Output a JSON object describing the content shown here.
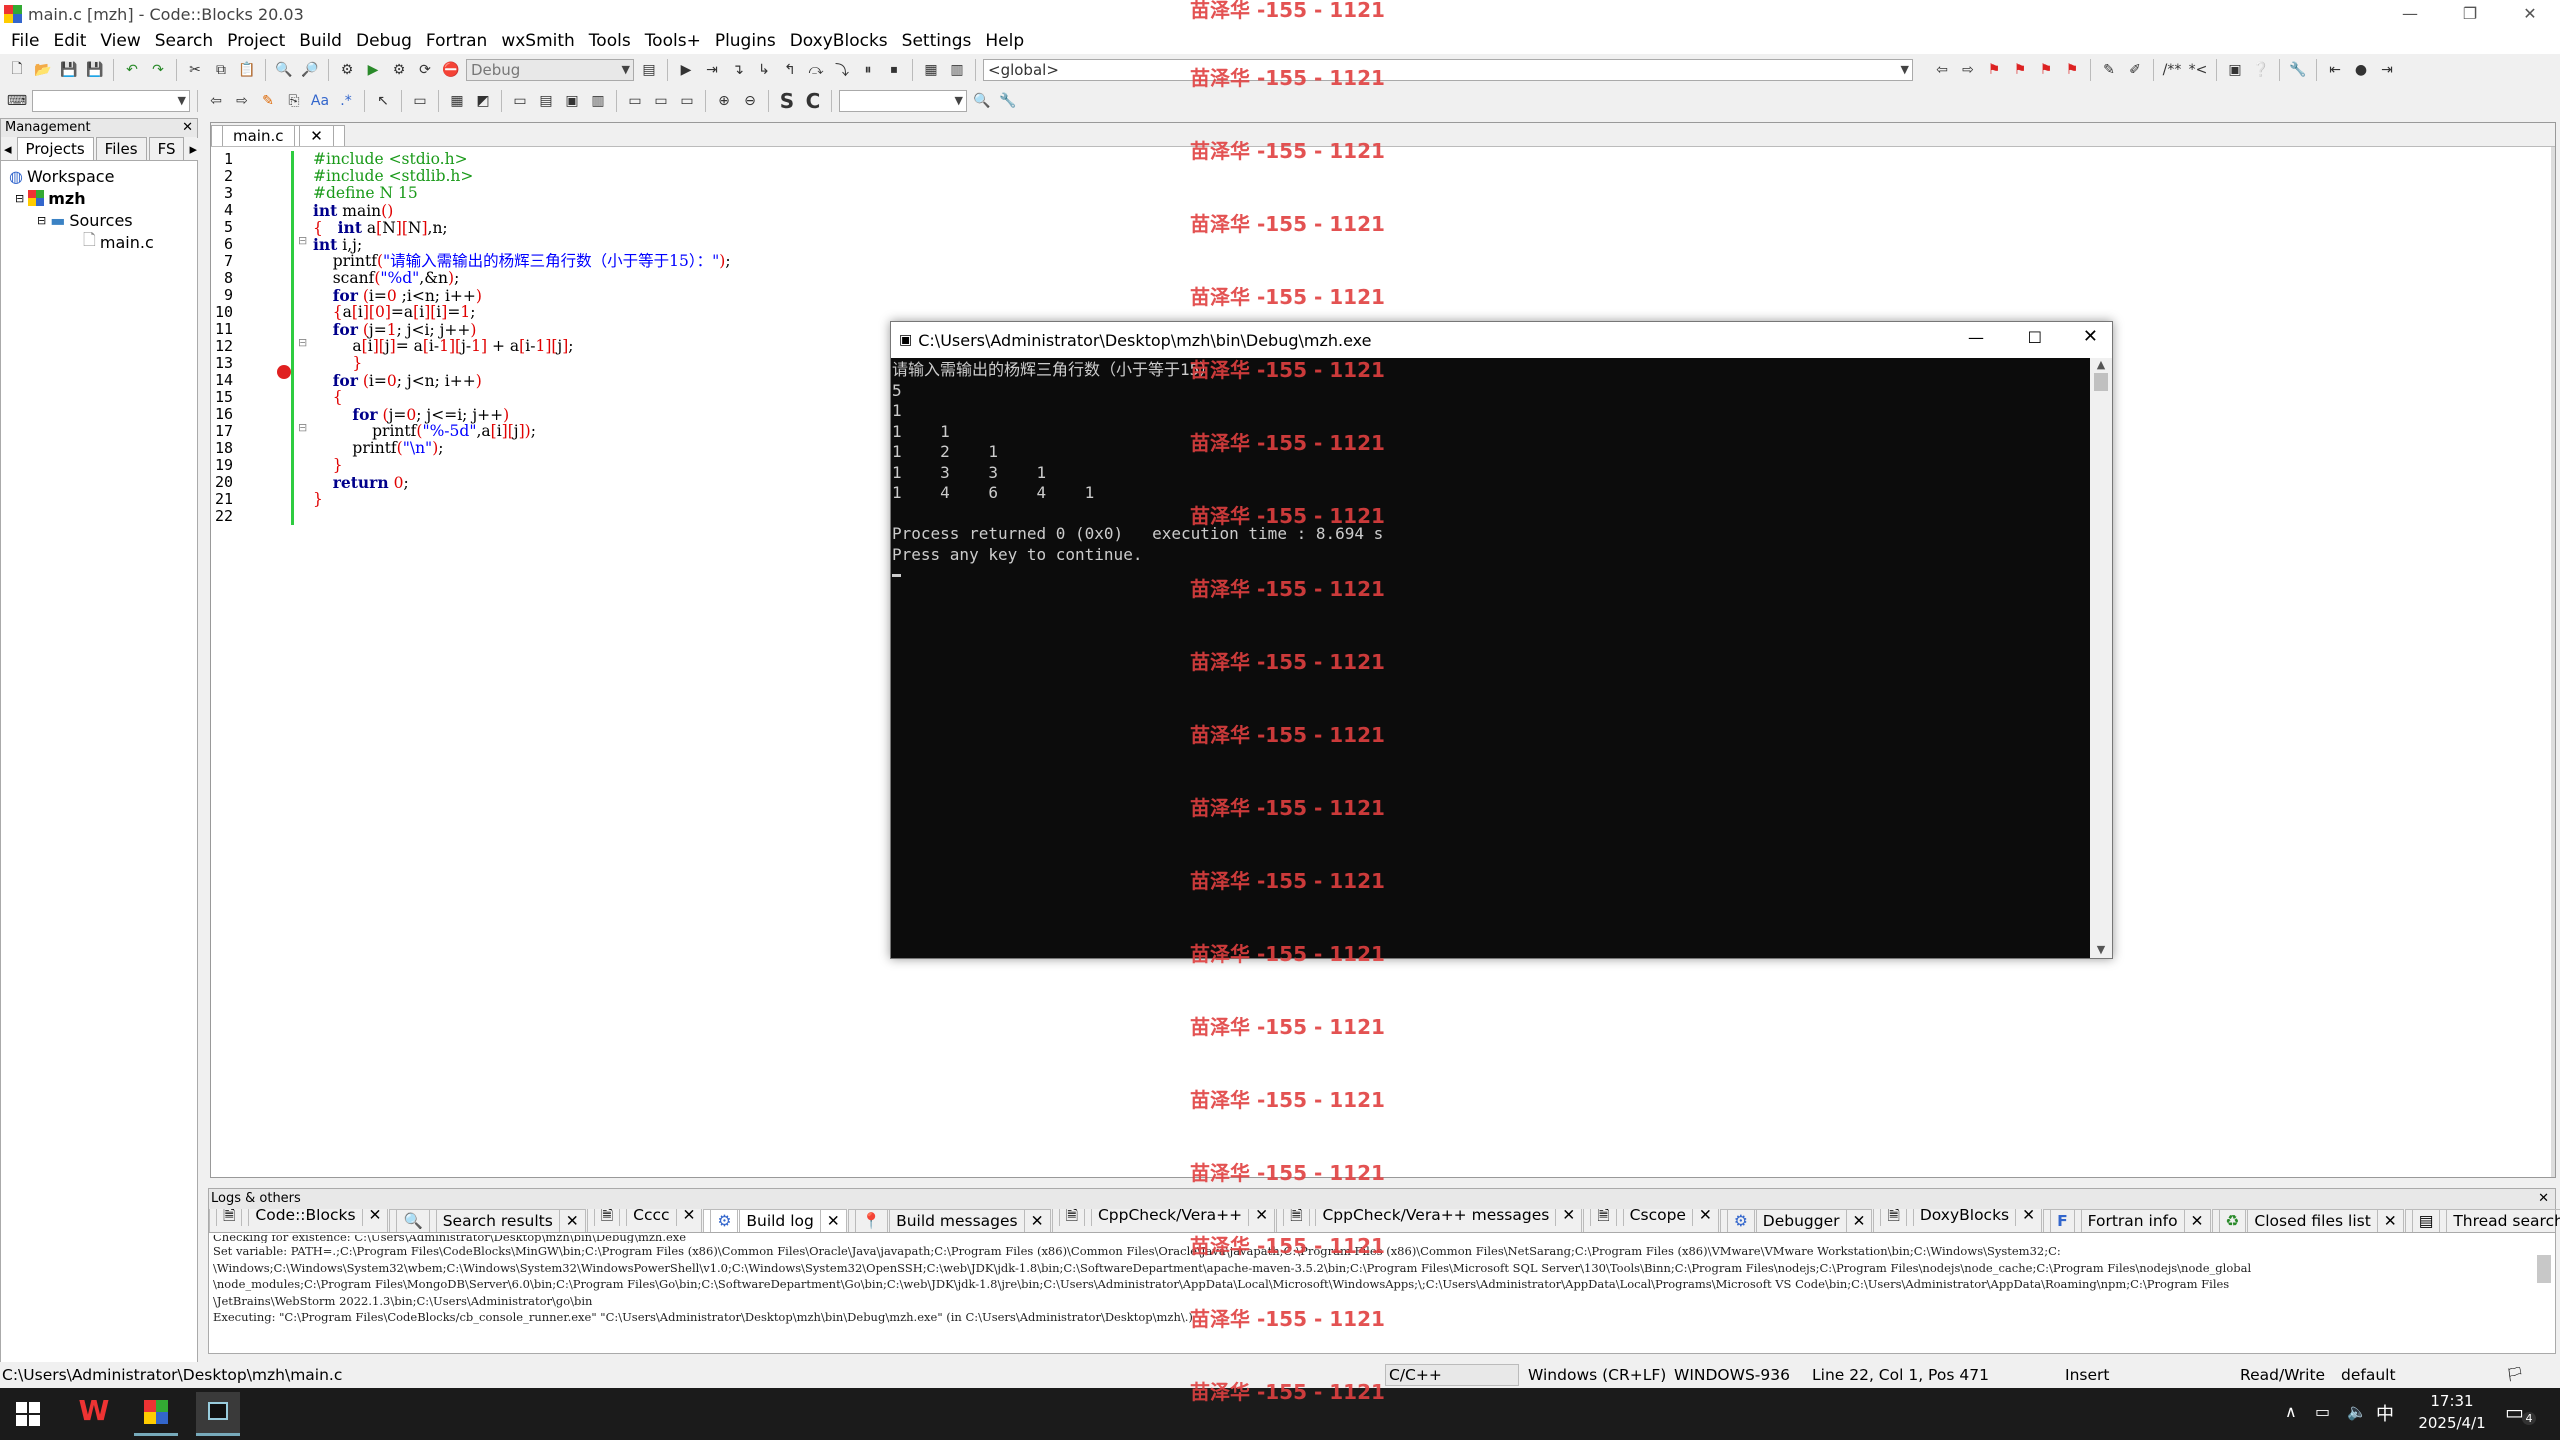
{
  "window": {
    "title": "main.c [mzh] - Code::Blocks 20.03"
  },
  "menu": [
    "File",
    "Edit",
    "View",
    "Search",
    "Project",
    "Build",
    "Debug",
    "Fortran",
    "wxSmith",
    "Tools",
    "Tools+",
    "Plugins",
    "DoxyBlocks",
    "Settings",
    "Help"
  ],
  "toolbar": {
    "build_target": "Debug",
    "scope": "<global>"
  },
  "management": {
    "header": "Management",
    "tabs": [
      "Projects",
      "Files",
      "FS"
    ],
    "workspace": "Workspace",
    "project": "mzh",
    "folder": "Sources",
    "file": "main.c"
  },
  "editor": {
    "tab": "main.c",
    "line_numbers": [
      "1",
      "2",
      "3",
      "4",
      "5",
      "6",
      "7",
      "8",
      "9",
      "10",
      "11",
      "12",
      "13",
      "14",
      "15",
      "16",
      "17",
      "18",
      "19",
      "20",
      "21",
      "22"
    ]
  },
  "console": {
    "title": "C:\\Users\\Administrator\\Desktop\\mzh\\bin\\Debug\\mzh.exe",
    "lines": [
      "请输入需输出的杨辉三角行数（小于等于15）",
      "5",
      "1",
      "1    1",
      "1    2    1",
      "1    3    3    1",
      "1    4    6    4    1",
      "",
      "Process returned 0 (0x0)   execution time : 8.694 s",
      "Press any key to continue."
    ]
  },
  "logs": {
    "header": "Logs & others",
    "tabs": [
      "Code::Blocks",
      "Search results",
      "Cccc",
      "Build log",
      "Build messages",
      "CppCheck/Vera++",
      "CppCheck/Vera++ messages",
      "Cscope",
      "Debugger",
      "DoxyBlocks",
      "Fortran info",
      "Closed files list",
      "Thread search"
    ],
    "lines": [
      "Checking for existence: C:\\Users\\Administrator\\Desktop\\mzh\\bin\\Debug\\mzh.exe",
      "Set variable: PATH=.;C:\\Program Files\\CodeBlocks\\MinGW\\bin;C:\\Program Files (x86)\\Common Files\\Oracle\\Java\\javapath;C:\\Program Files (x86)\\Common Files\\Oracle\\Java\\javapath;C:\\Program Files (x86)\\Common Files\\NetSarang;C:\\Program Files (x86)\\VMware\\VMware Workstation\\bin;C:\\Windows\\System32;C:",
      "\\Windows;C:\\Windows\\System32\\wbem;C:\\Windows\\System32\\WindowsPowerShell\\v1.0;C:\\Windows\\System32\\OpenSSH;C:\\web\\JDK\\jdk-1.8\\bin;C:\\SoftwareDepartment\\apache-maven-3.5.2\\bin;C:\\Program Files\\Microsoft SQL Server\\130\\Tools\\Binn;C:\\Program Files\\nodejs;C:\\Program Files\\nodejs\\node_cache;C:\\Program Files\\nodejs\\node_global",
      "\\node_modules;C:\\Program Files\\MongoDB\\Server\\6.0\\bin;C:\\Program Files\\Go\\bin;C:\\SoftwareDepartment\\Go\\bin;C:\\web\\JDK\\jdk-1.8\\jre\\bin;C:\\Users\\Administrator\\AppData\\Local\\Microsoft\\WindowsApps;\\;C:\\Users\\Administrator\\AppData\\Local\\Programs\\Microsoft VS Code\\bin;C:\\Users\\Administrator\\AppData\\Roaming\\npm;C:\\Program Files",
      "\\JetBrains\\WebStorm 2022.1.3\\bin;C:\\Users\\Administrator\\go\\bin",
      "Executing: \"C:\\Program Files\\CodeBlocks/cb_console_runner.exe\" \"C:\\Users\\Administrator\\Desktop\\mzh\\bin\\Debug\\mzh.exe\"  (in C:\\Users\\Administrator\\Desktop\\mzh\\.)"
    ]
  },
  "status": {
    "path": "C:\\Users\\Administrator\\Desktop\\mzh\\main.c",
    "lang": "C/C++",
    "eol": "Windows (CR+LF)",
    "encoding": "WINDOWS-936",
    "position": "Line 22, Col 1, Pos 471",
    "mode": "Insert",
    "access": "Read/Write",
    "profile": "default"
  },
  "taskbar": {
    "time": "17:31",
    "date": "2025/4/1",
    "ime": "中",
    "notifications": "4"
  },
  "watermark": "苗泽华 -155 - 1121",
  "colors": {
    "keyword": "#00008b",
    "preprocessor": "#1a9a1a",
    "string": "#0000ff",
    "number": "#e00000",
    "console_bg": "#0c0c0c",
    "watermark": "#e04040"
  }
}
